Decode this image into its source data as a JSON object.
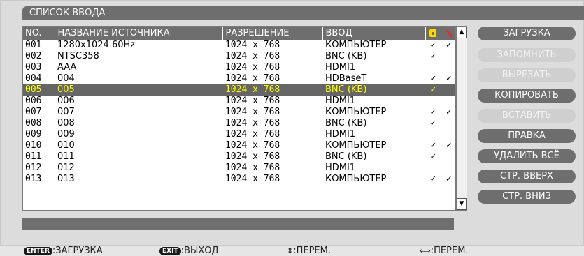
{
  "window": {
    "title": "СПИСОК ВВОДА"
  },
  "table": {
    "headers": [
      "NO.",
      "НАЗВАНИЕ ИСТОЧНИКА",
      "РАЗРЕШЕНИЕ",
      "ВВОД"
    ],
    "lock_icon": "lock-icon",
    "edit_icon": "wrench-icon",
    "selected_row": 4,
    "rows": [
      {
        "no": "001",
        "name": "1280x1024 60Hz",
        "res": "1024 x 768",
        "input": "КОМПЬЮТЕР",
        "lock": "✓",
        "edit": "✓"
      },
      {
        "no": "002",
        "name": "NTSC358",
        "res": "1024 x 768",
        "input": "BNC (KB)",
        "lock": "✓",
        "edit": ""
      },
      {
        "no": "003",
        "name": "AAA",
        "res": "1024 x 768",
        "input": "HDMI1",
        "lock": "",
        "edit": ""
      },
      {
        "no": "004",
        "name": "004",
        "res": "1024 x 768",
        "input": "HDBaseT",
        "lock": "✓",
        "edit": "✓"
      },
      {
        "no": "005",
        "name": "005",
        "res": "1024 x 768",
        "input": "BNC (KB)",
        "lock": "✓",
        "edit": ""
      },
      {
        "no": "006",
        "name": "006",
        "res": "1024 x 768",
        "input": "HDMI1",
        "lock": "",
        "edit": ""
      },
      {
        "no": "007",
        "name": "007",
        "res": "1024 x 768",
        "input": "КОМПЬЮТЕР",
        "lock": "✓",
        "edit": "✓"
      },
      {
        "no": "008",
        "name": "008",
        "res": "1024 x 768",
        "input": "BNC (KB)",
        "lock": "✓",
        "edit": ""
      },
      {
        "no": "009",
        "name": "009",
        "res": "1024 x 768",
        "input": "HDMI1",
        "lock": "",
        "edit": ""
      },
      {
        "no": "010",
        "name": "010",
        "res": "1024 x 768",
        "input": "КОМПЬЮТЕР",
        "lock": "✓",
        "edit": "✓"
      },
      {
        "no": "011",
        "name": "011",
        "res": "1024 x 768",
        "input": "BNC (KB)",
        "lock": "✓",
        "edit": ""
      },
      {
        "no": "012",
        "name": "012",
        "res": "1024 x 768",
        "input": "HDMI1",
        "lock": "",
        "edit": ""
      },
      {
        "no": "013",
        "name": "013",
        "res": "1024 x 768",
        "input": "КОМПЬЮТЕР",
        "lock": "✓",
        "edit": "✓"
      }
    ]
  },
  "scrollbar": {
    "up_arrow": "▲",
    "down_arrow": "▼"
  },
  "buttons": [
    {
      "label": "ЗАГРУЗКА",
      "state": "active"
    },
    {
      "label": "ЗАПОМНИТЬ",
      "state": "disabled"
    },
    {
      "label": "ВЫРЕЗАТЬ",
      "state": "disabled"
    },
    {
      "label": "КОПИРОВАТЬ",
      "state": "active"
    },
    {
      "label": "ВСТАВИТЬ",
      "state": "disabled"
    },
    {
      "label": "ПРАВКА",
      "state": "active"
    },
    {
      "label": "УДАЛИТЬ ВСЁ",
      "state": "active"
    },
    {
      "label": "СТР. ВВЕРХ",
      "state": "active"
    },
    {
      "label": "СТР. ВНИЗ",
      "state": "active"
    }
  ],
  "footer": {
    "enter_key": "ENTER",
    "enter_label": ":ЗАГРУЗКА",
    "exit_key": "EXIT",
    "exit_label": ":ВЫХОД",
    "updown_symbol": "⇕",
    "updown_label": ":ПЕРЕМ.",
    "leftright_symbol": "⟺",
    "leftright_label": ":ПЕРЕМ."
  },
  "colors": {
    "panel": "#dcdcdc",
    "header": "#6e6e6e",
    "selected_text": "#ffff00",
    "lock_icon": "#ffd800",
    "edit_icon": "#e03030"
  }
}
